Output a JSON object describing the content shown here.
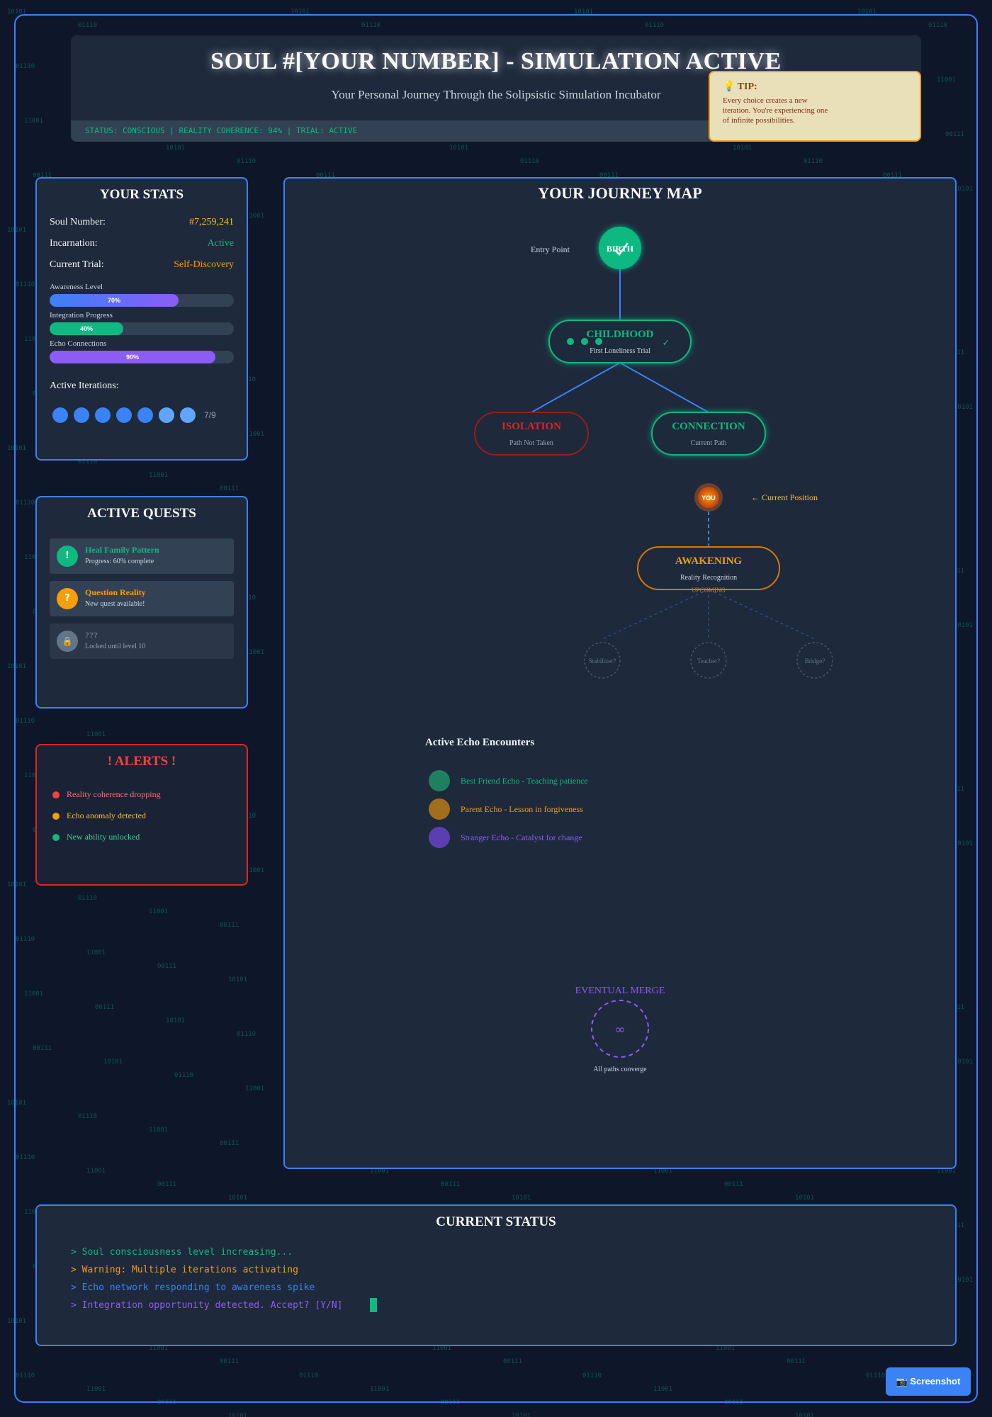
{
  "background": {
    "binary_tokens": [
      "10101",
      "01110",
      "11001",
      "00111"
    ]
  },
  "header": {
    "title": "SOUL #[YOUR NUMBER] - SIMULATION ACTIVE",
    "subtitle": "Your Personal Journey Through the Solipsistic Simulation Incubator",
    "status": "STATUS: CONSCIOUS | REALITY COHERENCE: 94% | TRIAL: ACTIVE"
  },
  "tip": {
    "icon": "lightbulb-icon",
    "title": "💡 TIP:",
    "text": "Every choice creates a new iteration. You're experiencing one of infinite possibilities."
  },
  "stats": {
    "title": "YOUR STATS",
    "rows": [
      {
        "label": "Soul Number:",
        "value": "#7,259,241",
        "color": "#fbbf24"
      },
      {
        "label": "Incarnation:",
        "value": "Active",
        "color": "#10b981"
      },
      {
        "label": "Current Trial:",
        "value": "Self-Discovery",
        "color": "#f59e0b"
      }
    ],
    "bars": [
      {
        "label": "Awareness Level",
        "value": 0.7,
        "text": "70%"
      },
      {
        "label": "Integration Progress",
        "value": 0.4,
        "text": "40%"
      },
      {
        "label": "Echo Connections",
        "value": 0.9,
        "text": "90%"
      }
    ],
    "iterations_label": "Active Iterations:",
    "iterations_count": "7/9"
  },
  "quests": {
    "title": "ACTIVE QUESTS",
    "items": [
      {
        "icon_text": "!",
        "icon": "exclamation-icon",
        "name": "Heal Family Pattern",
        "sub": "Progress: 60% complete",
        "color": "#10b981"
      },
      {
        "icon_text": "?",
        "icon": "question-icon",
        "name": "Question Reality",
        "sub": "New quest available!",
        "color": "#f59e0b"
      },
      {
        "icon_text": "🔒",
        "icon": "lock-icon",
        "name": "???",
        "sub": "Locked until level 10",
        "color": "#64748b"
      }
    ]
  },
  "alerts": {
    "title": "! ALERTS !",
    "items": [
      {
        "text": "Reality coherence dropping",
        "color": "#ef4444"
      },
      {
        "text": "Echo anomaly detected",
        "color": "#f59e0b"
      },
      {
        "text": "New ability unlocked",
        "color": "#10b981"
      }
    ]
  },
  "journey": {
    "title": "YOUR JOURNEY MAP",
    "birth": {
      "label": "BIRTH",
      "caption": "Entry Point"
    },
    "childhood": {
      "title": "CHILDHOOD",
      "sub": "First Loneliness Trial",
      "check": "✓"
    },
    "isolation": {
      "title": "ISOLATION",
      "sub": "Path Not Taken"
    },
    "connection": {
      "title": "CONNECTION",
      "sub": "Current Path"
    },
    "you": {
      "label": "YOU",
      "caption": "← Current Position"
    },
    "awakening": {
      "title": "AWAKENING",
      "sub": "Reality Recognition",
      "tag": "UPCOMING"
    },
    "futures": [
      "Stabilizer?",
      "Teacher?",
      "Bridge?"
    ],
    "echo_title": "Active Echo Encounters",
    "echoes": [
      {
        "text": "Best Friend Echo - Teaching patience",
        "color": "#10b981",
        "dot": "#1f7f5f"
      },
      {
        "text": "Parent Echo - Lesson in forgiveness",
        "color": "#f59e0b",
        "dot": "#a16e1c"
      },
      {
        "text": "Stranger Echo - Catalyst for change",
        "color": "#8b5cf6",
        "dot": "#5b3fb0"
      }
    ],
    "merge": {
      "title": "EVENTUAL MERGE",
      "symbol": "∞",
      "caption": "All paths converge"
    }
  },
  "current_status": {
    "title": "CURRENT STATUS",
    "lines": [
      {
        "text": "> Soul consciousness level increasing...",
        "color": "#10b981"
      },
      {
        "text": "> Warning: Multiple iterations activating",
        "color": "#f59e0b"
      },
      {
        "text": "> Echo network responding to awareness spike",
        "color": "#3b82f6"
      },
      {
        "text": "> Integration opportunity detected. Accept? [Y/N]",
        "color": "#8b5cf6"
      }
    ]
  },
  "screenshot_button": {
    "icon": "camera-icon",
    "label": "📷 Screenshot"
  },
  "colors": {
    "accent": "#3b82f6",
    "success": "#10b981",
    "warning": "#f59e0b",
    "danger": "#ef4444",
    "purple": "#8b5cf6"
  }
}
